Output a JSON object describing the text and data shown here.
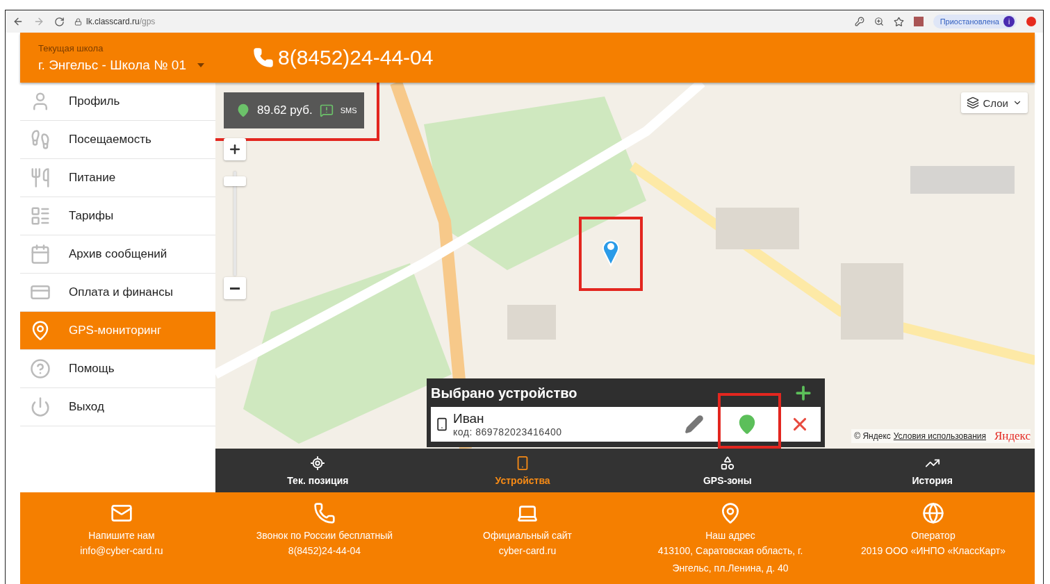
{
  "browser": {
    "host": "lk.classcard.ru",
    "path": "/gps",
    "profile_status": "Приостановлена",
    "avatar_letter": "i"
  },
  "header": {
    "school_label": "Текущая школа",
    "school_name": "г. Энгельс - Школа № 01",
    "phone": "8(8452)24-44-04"
  },
  "sidebar": {
    "items": [
      {
        "label": "Профиль",
        "selected": false
      },
      {
        "label": "Посещаемость",
        "selected": false
      },
      {
        "label": "Питание",
        "selected": false
      },
      {
        "label": "Тарифы",
        "selected": false
      },
      {
        "label": "Архив сообщений",
        "selected": false
      },
      {
        "label": "Оплата и финансы",
        "selected": false
      },
      {
        "label": "GPS-мониторинг",
        "selected": true
      },
      {
        "label": "Помощь",
        "selected": false
      },
      {
        "label": "Выход",
        "selected": false
      }
    ]
  },
  "map": {
    "balance": {
      "amount": "89.62 руб.",
      "sms": "SMS",
      "highlighted": true
    },
    "zoom": {
      "level": 0.95
    },
    "layers": "Слои",
    "marker": {
      "highlighted": true
    },
    "device_panel": {
      "title": "Выбрано устройство",
      "devices": [
        {
          "name": "Иван",
          "code": "код: 869782023416400",
          "locate_highlighted": true
        }
      ]
    },
    "attribution": {
      "copyright": "© Яндекс",
      "terms": "Условия использования",
      "logo": "Яндекс"
    }
  },
  "nav_tabs": [
    {
      "label": "Тек. позиция",
      "selected": false
    },
    {
      "label": "Устройства",
      "selected": true
    },
    {
      "label": "GPS-зоны",
      "selected": false
    },
    {
      "label": "История",
      "selected": false
    }
  ],
  "footer": {
    "columns": [
      {
        "title": "Напишите нам",
        "value": "info@cyber-card.ru"
      },
      {
        "title": "Звонок по России бесплатный",
        "value": "8(8452)24-44-04"
      },
      {
        "title": "Официальный сайт",
        "value": "cyber-card.ru"
      },
      {
        "title": "Наш адрес",
        "value": "413100, Саратовская область, г. Энгельс, пл.Ленина, д. 40"
      },
      {
        "title": "Оператор",
        "value": "2019 ООО «ИНПО «КлассКарт»"
      }
    ]
  }
}
